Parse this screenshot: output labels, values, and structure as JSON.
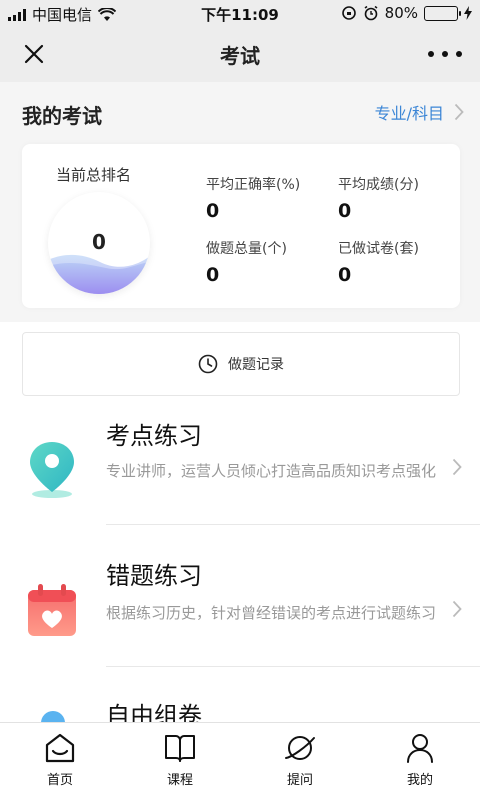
{
  "status_bar": {
    "carrier": "中国电信",
    "time": "下午11:09",
    "battery": "80%",
    "battery_level": 0.8
  },
  "nav": {
    "title": "考试"
  },
  "my_exam": {
    "heading": "我的考试",
    "subject_link": "专业/科目"
  },
  "stats": {
    "rank_label": "当前总排名",
    "rank_value": "0",
    "items": [
      {
        "label": "平均正确率(%)",
        "value": "0"
      },
      {
        "label": "平均成绩(分)",
        "value": "0"
      },
      {
        "label": "做题总量(个)",
        "value": "0"
      },
      {
        "label": "已做试卷(套)",
        "value": "0"
      }
    ]
  },
  "record": {
    "label": "做题记录"
  },
  "features": [
    {
      "title": "考点练习",
      "desc": "专业讲师，运营人员倾心打造高品质知识考点强化",
      "icon": "location-pin-icon"
    },
    {
      "title": "错题练习",
      "desc": "根据练习历史，针对曾经错误的考点进行试题练习",
      "icon": "calendar-heart-icon"
    },
    {
      "title": "自由组卷",
      "desc": "",
      "icon": "balloon-icon"
    }
  ],
  "tabbar": {
    "items": [
      {
        "label": "首页",
        "icon": "home-icon"
      },
      {
        "label": "课程",
        "icon": "book-icon"
      },
      {
        "label": "提问",
        "icon": "planet-icon"
      },
      {
        "label": "我的",
        "icon": "user-icon"
      }
    ]
  },
  "colors": {
    "accent": "#3c86d6",
    "teal": "#3cc6b8",
    "coral": "#f26a6a",
    "wave": "#9a8df0"
  }
}
